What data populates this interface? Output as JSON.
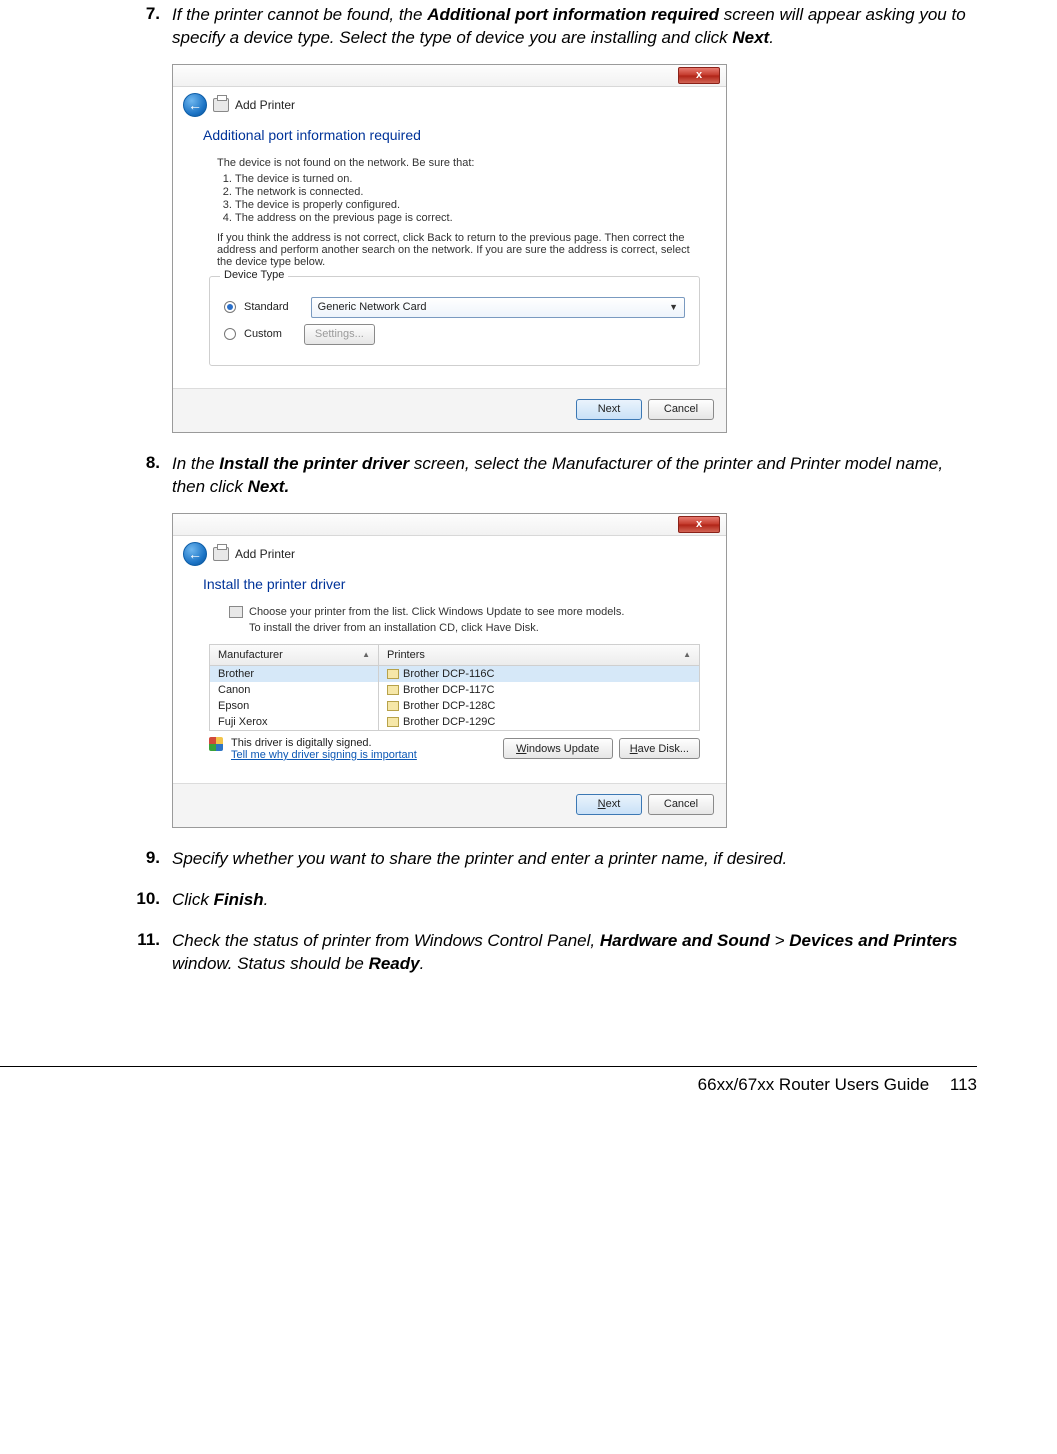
{
  "steps": {
    "s7": {
      "num": "7.",
      "text_a": "If the printer cannot be found, the ",
      "bold_a": "Additional port information required",
      "text_b": " screen will appear asking you to specify a device type. Select the type of device you are installing and click ",
      "bold_b": "Next",
      "text_c": "."
    },
    "s8": {
      "num": "8.",
      "text_a": "In the ",
      "bold_a": "Install the printer driver",
      "text_b": " screen, select the Manufacturer of the printer and Printer model name, then click ",
      "bold_b": "Next.",
      "text_c": ""
    },
    "s9": {
      "num": "9.",
      "text": "Specify whether you want to share the printer and enter a printer name, if desired."
    },
    "s10": {
      "num": "10.",
      "text_a": "Click ",
      "bold_a": "Finish",
      "text_b": "."
    },
    "s11": {
      "num": "11.",
      "text_a": " Check the status of printer from Windows Control Panel, ",
      "bold_a": "Hardware and Sound",
      "text_b": " > ",
      "bold_b": "Devices and Printers",
      "text_c": " window. Status should be ",
      "bold_c": "Ready",
      "text_d": "."
    }
  },
  "dlg1": {
    "close": "x",
    "back_glyph": "←",
    "header": "Add Printer",
    "title": "Additional port information required",
    "intro": "The device is not found on the network.  Be sure that:",
    "checks": [
      "The device is turned on.",
      "The network is connected.",
      "The device is properly configured.",
      "The address on the previous page is correct."
    ],
    "hint": "If you think the address is not correct, click Back to return to the previous page.  Then correct the address and perform another search on the network.  If you are sure the address is correct, select the device type below.",
    "devtype_legend": "Device Type",
    "radio_standard": "Standard",
    "radio_custom": "Custom",
    "combo_value": "Generic Network Card",
    "settings_btn": "Settings...",
    "next_btn": "Next",
    "cancel_btn": "Cancel"
  },
  "dlg2": {
    "close": "x",
    "back_glyph": "←",
    "header": "Add Printer",
    "title": "Install the printer driver",
    "line1": "Choose your printer from the list. Click Windows Update to see more models.",
    "line2": "To install the driver from an installation CD, click Have Disk.",
    "col_mfr": "Manufacturer",
    "col_prn": "Printers",
    "mfrs": [
      "Brother",
      "Canon",
      "Epson",
      "Fuji Xerox"
    ],
    "prns": [
      "Brother DCP-116C",
      "Brother DCP-117C",
      "Brother DCP-128C",
      "Brother DCP-129C"
    ],
    "signed": "This driver is digitally signed.",
    "why_link": "Tell me why driver signing is important",
    "winupdate_btn_pre": "W",
    "winupdate_btn": "indows Update",
    "havedisk_btn_pre": "H",
    "havedisk_btn": "ave Disk...",
    "next_btn_pre": "N",
    "next_btn": "ext",
    "cancel_btn": "Cancel"
  },
  "footer": {
    "title": "66xx/67xx Router Users Guide",
    "page": "113"
  }
}
